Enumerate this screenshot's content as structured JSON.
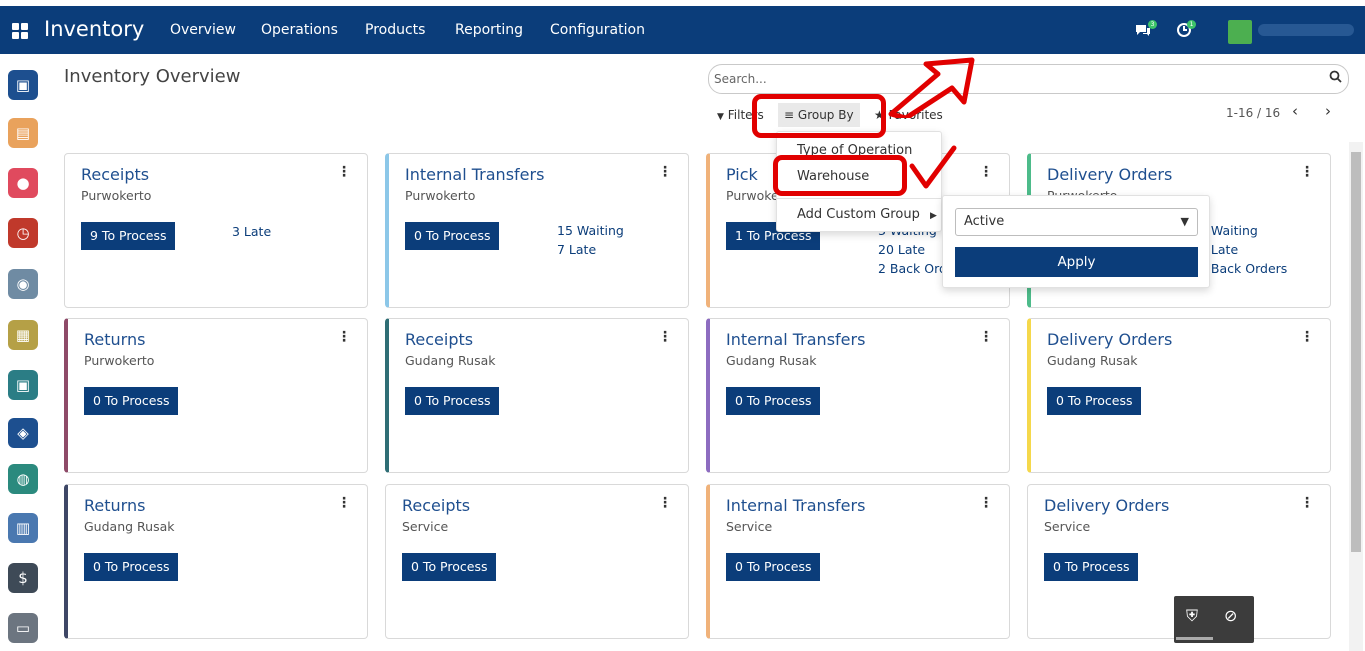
{
  "topbar": {
    "brand": "Inventory",
    "nav": [
      "Overview",
      "Operations",
      "Products",
      "Reporting",
      "Configuration"
    ],
    "icons": {
      "apps": "grid-icon",
      "chat": "chat-icon",
      "activity": "clock-icon"
    },
    "chat_badge": "3",
    "activity_badge": "1"
  },
  "page": {
    "title": "Inventory Overview"
  },
  "search": {
    "placeholder": "Search..."
  },
  "filters": {
    "filters_label": "Filters",
    "group_by_label": "Group By",
    "favorites_label": "Favorites",
    "pager": "1-16 / 16"
  },
  "group_by_menu": {
    "items": [
      "Type of Operation",
      "Warehouse"
    ],
    "custom_group_label": "Add Custom Group",
    "select_value": "Active",
    "apply_label": "Apply"
  },
  "cards": [
    {
      "title": "Receipts",
      "sub": "Purwokerto",
      "btn": "9 To Process",
      "stats": [
        "3 Late"
      ],
      "accent": ""
    },
    {
      "title": "Internal Transfers",
      "sub": "Purwokerto",
      "btn": "0 To Process",
      "stats": [
        "15 Waiting",
        "7 Late"
      ],
      "accent": "#8cc7e8"
    },
    {
      "title": "Pick",
      "sub": "Purwokerto",
      "btn": "1 To Process",
      "stats": [
        "3 Waiting",
        "20 Late",
        "2 Back Orders"
      ],
      "accent": "#f0b27a"
    },
    {
      "title": "Delivery Orders",
      "sub": "Purwokerto",
      "btn": "0 To Process",
      "stats": [
        "3 Waiting",
        "7 Late",
        "3 Back Orders"
      ],
      "accent": "#4dbb8a"
    },
    {
      "title": "Returns",
      "sub": "Purwokerto",
      "btn": "0 To Process",
      "stats": [],
      "accent": "#8e4a68"
    },
    {
      "title": "Receipts",
      "sub": "Gudang Rusak",
      "btn": "0 To Process",
      "stats": [],
      "accent": "#2f6e75"
    },
    {
      "title": "Internal Transfers",
      "sub": "Gudang Rusak",
      "btn": "0 To Process",
      "stats": [],
      "accent": "#8d6cc0"
    },
    {
      "title": "Delivery Orders",
      "sub": "Gudang Rusak",
      "btn": "0 To Process",
      "stats": [],
      "accent": "#f5d84b"
    },
    {
      "title": "Returns",
      "sub": "Gudang Rusak",
      "btn": "0 To Process",
      "stats": [],
      "accent": "#3e4766"
    },
    {
      "title": "Receipts",
      "sub": "Service",
      "btn": "0 To Process",
      "stats": [],
      "accent": ""
    },
    {
      "title": "Internal Transfers",
      "sub": "Service",
      "btn": "0 To Process",
      "stats": [],
      "accent": "#f0b27a"
    },
    {
      "title": "Delivery Orders",
      "sub": "Service",
      "btn": "0 To Process",
      "stats": [],
      "accent": ""
    }
  ],
  "sidebar_apps": [
    {
      "icon": "screen-icon",
      "color": "#1d4f8f"
    },
    {
      "icon": "box-icon",
      "color": "#e9a25c"
    },
    {
      "icon": "chat-icon",
      "color": "#e04a5e"
    },
    {
      "icon": "timer-icon",
      "color": "#c0392b"
    },
    {
      "icon": "employees-icon",
      "color": "#6f8ba3"
    },
    {
      "icon": "calendar-icon",
      "color": "#b5a046"
    },
    {
      "icon": "monitor-icon",
      "color": "#2b7d85"
    },
    {
      "icon": "seal-icon",
      "color": "#1d4f8f"
    },
    {
      "icon": "dashboard-icon",
      "color": "#2b8a7e"
    },
    {
      "icon": "boxes-icon",
      "color": "#4a78b0"
    },
    {
      "icon": "payroll-icon",
      "color": "#3e4a57"
    },
    {
      "icon": "note-icon",
      "color": "#6c7580"
    }
  ],
  "colors": {
    "primary": "#0b3d7a",
    "highlight": "#e10000"
  }
}
